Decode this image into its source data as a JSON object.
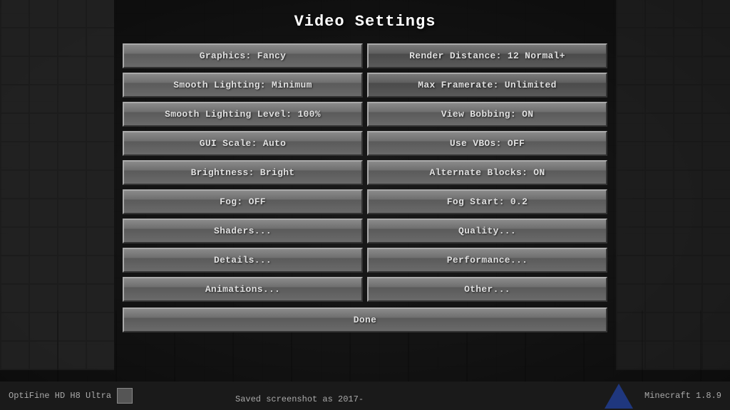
{
  "title": "Video Settings",
  "buttons": {
    "left": [
      {
        "id": "graphics",
        "label": "Graphics: Fancy"
      },
      {
        "id": "smooth-lighting",
        "label": "Smooth Lighting: Minimum"
      },
      {
        "id": "smooth-lighting-level",
        "label": "Smooth Lighting Level: 100%"
      },
      {
        "id": "gui-scale",
        "label": "GUI Scale: Auto"
      },
      {
        "id": "brightness",
        "label": "Brightness: Bright"
      },
      {
        "id": "fog",
        "label": "Fog: OFF"
      },
      {
        "id": "shaders",
        "label": "Shaders..."
      },
      {
        "id": "details",
        "label": "Details..."
      },
      {
        "id": "animations",
        "label": "Animations..."
      }
    ],
    "right": [
      {
        "id": "render-distance",
        "label": "Render Distance: 12 Normal+"
      },
      {
        "id": "max-framerate",
        "label": "Max Framerate: Unlimited"
      },
      {
        "id": "view-bobbing",
        "label": "View Bobbing: ON"
      },
      {
        "id": "use-vbos",
        "label": "Use VBOs: OFF"
      },
      {
        "id": "alternate-blocks",
        "label": "Alternate Blocks: ON"
      },
      {
        "id": "fog-start",
        "label": "Fog Start: 0.2"
      },
      {
        "id": "quality",
        "label": "Quality..."
      },
      {
        "id": "performance",
        "label": "Performance..."
      },
      {
        "id": "other",
        "label": "Other..."
      }
    ],
    "done": "Done"
  },
  "bottom": {
    "left_text": "Saved screenshot as 2017-",
    "right_text": "Minecraft 1.8.9",
    "branding": "OptiFine HD H8 Ultra"
  }
}
